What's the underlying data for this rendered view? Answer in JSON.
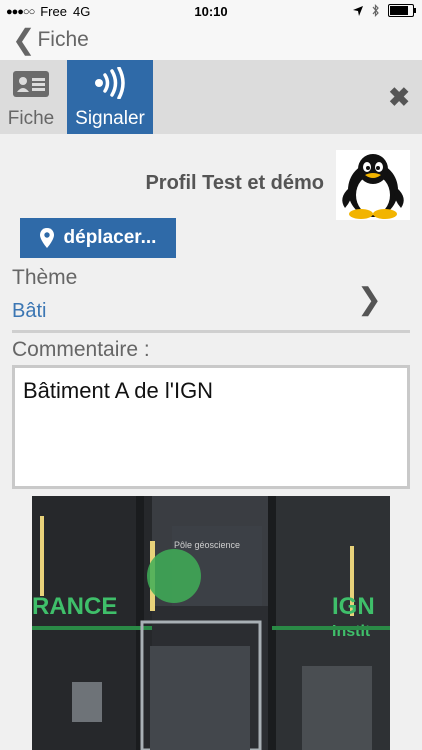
{
  "status": {
    "carrier": "Free",
    "network": "4G",
    "time": "10:10"
  },
  "nav": {
    "back_label": "Fiche"
  },
  "tabs": {
    "fiche": "Fiche",
    "signaler": "Signaler"
  },
  "profile": {
    "name": "Profil Test et démo"
  },
  "actions": {
    "move_label": "déplacer..."
  },
  "theme": {
    "label": "Thème",
    "value": "Bâti"
  },
  "comment": {
    "label": "Commentaire :",
    "value": "Bâtiment A de l'IGN"
  },
  "photo": {
    "sign_left": "RANCE",
    "sign_right": "IGN",
    "sign_right_sub": "Instit",
    "sign_center": "Pôle géoscience"
  },
  "colors": {
    "accent": "#2f6aa8",
    "link": "#3b76b3",
    "tabbar": "#dcdcdc",
    "background": "#f0f0f0"
  }
}
